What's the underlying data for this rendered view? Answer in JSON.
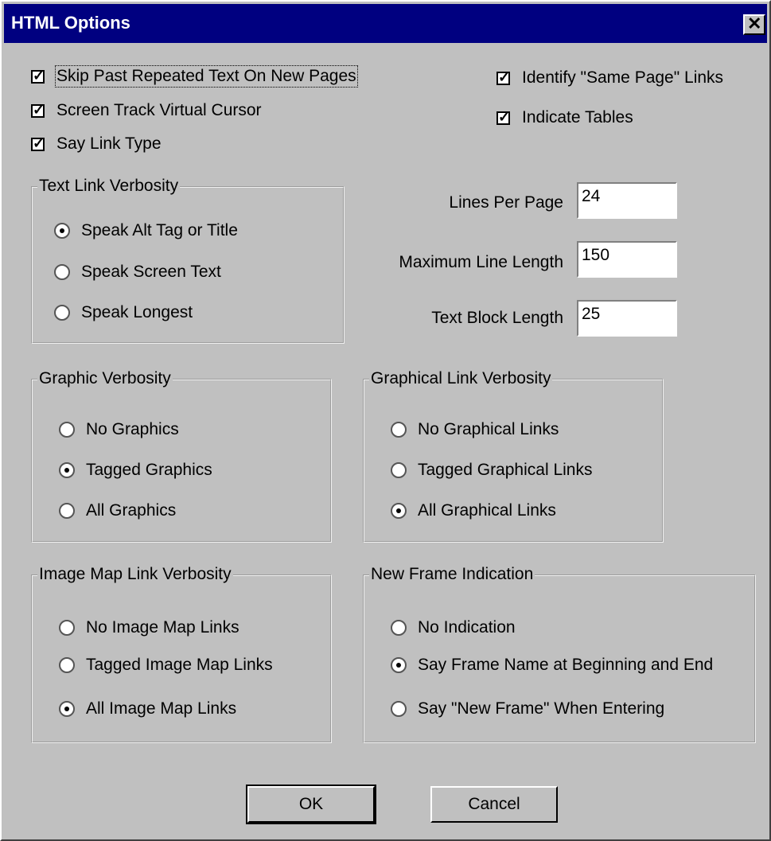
{
  "title": "HTML Options",
  "close_glyph": "✕",
  "check_glyph": "✓",
  "checkboxes": [
    {
      "label": "Skip Past Repeated Text On New Pages",
      "checked": true
    },
    {
      "label": "Screen Track Virtual Cursor",
      "checked": true
    },
    {
      "label": "Say Link Type",
      "checked": true
    },
    {
      "label": "Identify \"Same Page\" Links",
      "checked": true
    },
    {
      "label": "Indicate Tables",
      "checked": true
    }
  ],
  "text_link": {
    "legend": "Text Link Verbosity",
    "options": [
      "Speak Alt Tag or Title",
      "Speak Screen Text",
      "Speak Longest"
    ],
    "selected": 0
  },
  "fields": {
    "lines_per_page": {
      "label": "Lines Per Page",
      "value": "24"
    },
    "max_line_length": {
      "label": "Maximum Line Length",
      "value": "150"
    },
    "text_block_length": {
      "label": "Text Block Length",
      "value": "25"
    }
  },
  "graphic": {
    "legend": "Graphic Verbosity",
    "options": [
      "No Graphics",
      "Tagged Graphics",
      "All Graphics"
    ],
    "selected": 1
  },
  "graphical_link": {
    "legend": "Graphical Link Verbosity",
    "options": [
      "No Graphical Links",
      "Tagged Graphical Links",
      "All Graphical Links"
    ],
    "selected": 2
  },
  "image_map": {
    "legend": "Image Map Link Verbosity",
    "options": [
      "No Image Map Links",
      "Tagged Image Map Links",
      "All Image Map Links"
    ],
    "selected": 2
  },
  "new_frame": {
    "legend": "New Frame Indication",
    "options": [
      "No Indication",
      "Say Frame Name at Beginning and End",
      "Say \"New Frame\"  When Entering"
    ],
    "selected": 1
  },
  "buttons": {
    "ok": "OK",
    "cancel": "Cancel"
  }
}
